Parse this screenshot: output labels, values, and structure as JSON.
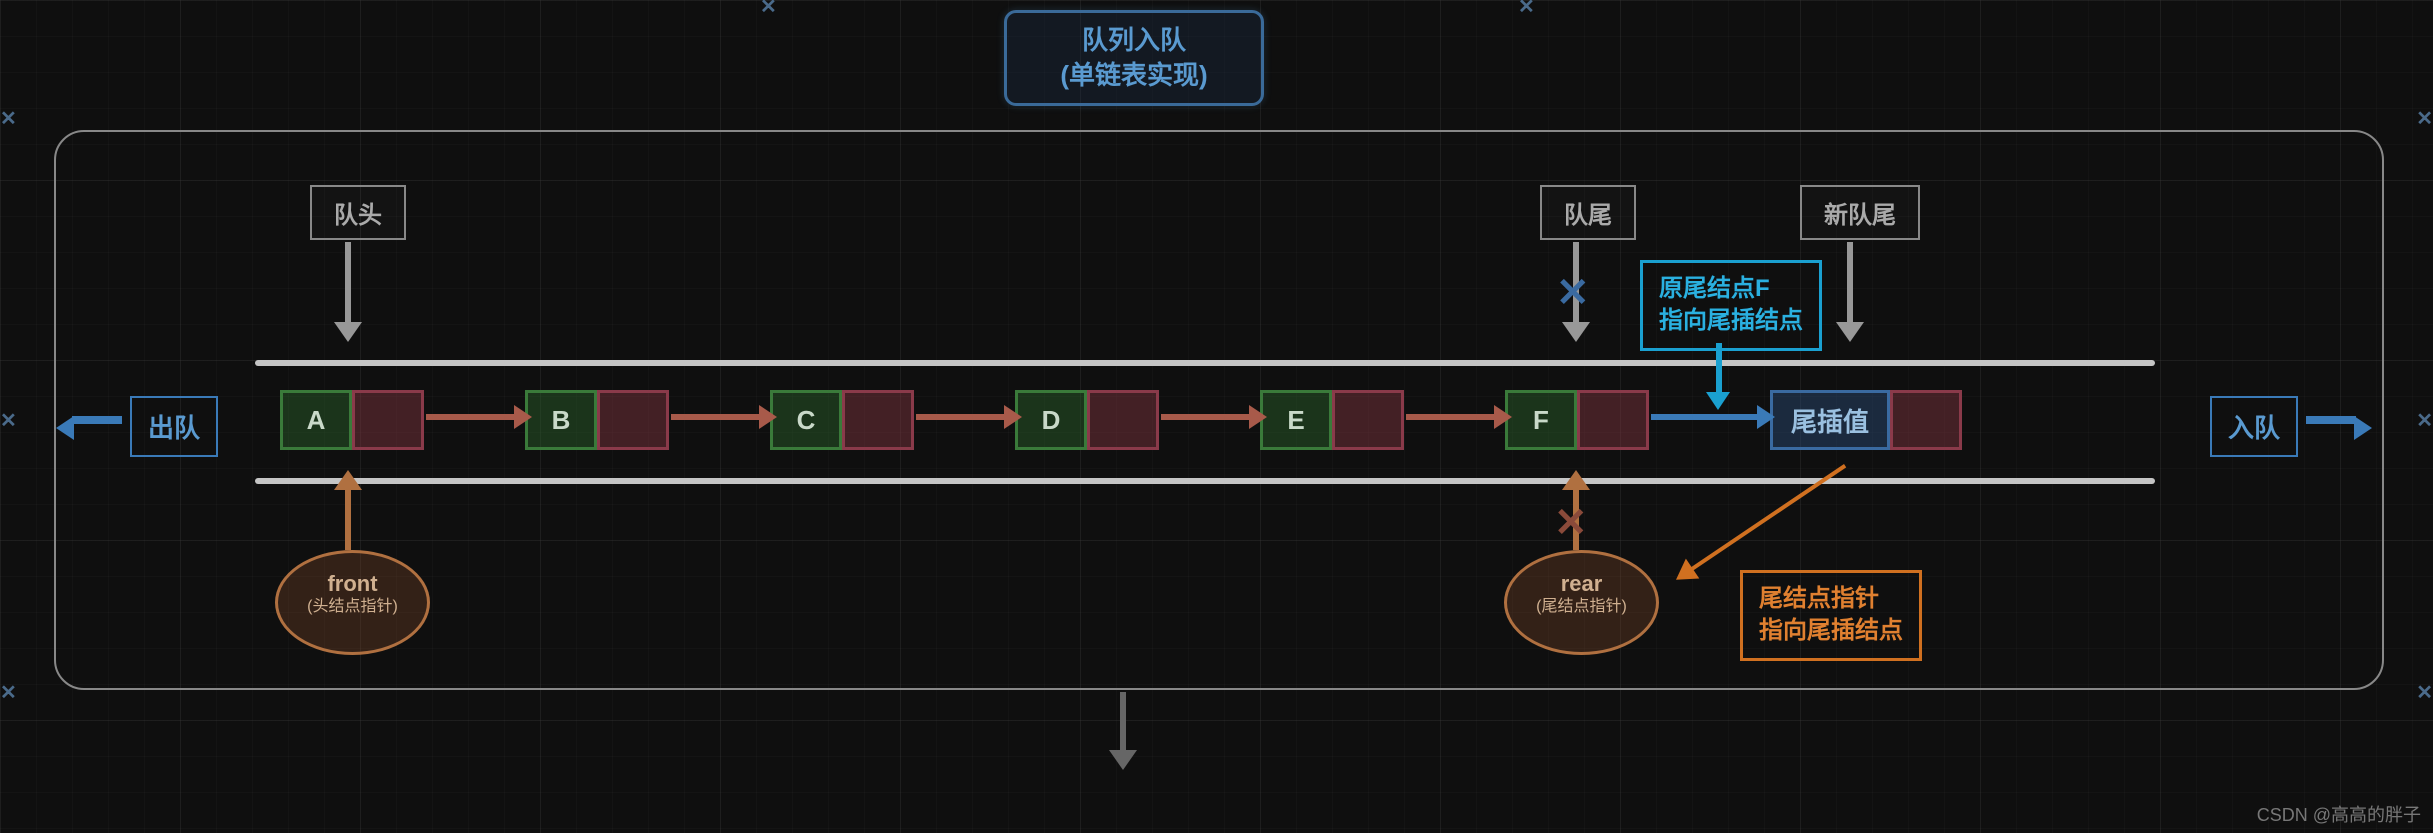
{
  "title": {
    "line1": "队列入队",
    "line2": "(单链表实现)"
  },
  "labels": {
    "head": "队头",
    "tail_old": "队尾",
    "tail_new": "新队尾",
    "dequeue": "出队",
    "enqueue": "入队"
  },
  "nodes": [
    "A",
    "B",
    "C",
    "D",
    "E",
    "F"
  ],
  "new_node_label": "尾插值",
  "front": {
    "name": "front",
    "desc": "(头结点指针)"
  },
  "rear": {
    "name": "rear",
    "desc": "(尾结点指针)"
  },
  "note_blue": {
    "l1": "原尾结点F",
    "l2": "指向尾插结点"
  },
  "note_orange": {
    "l1": "尾结点指针",
    "l2": "指向尾插结点"
  },
  "watermark": "CSDN @高高的胖子"
}
